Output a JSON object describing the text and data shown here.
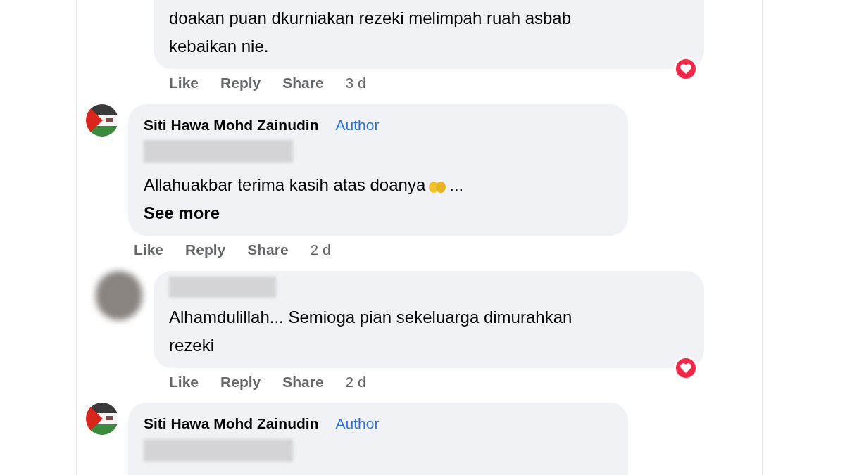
{
  "comments": [
    {
      "kind": "comment",
      "text": "doakan puan dkurniakan rezeki melimpah ruah asbab kebaikan nie.",
      "loved": true,
      "actions": [
        "Like",
        "Reply",
        "Share"
      ],
      "time": "3 d"
    },
    {
      "kind": "reply",
      "author": "Siti Hawa Mohd Zainudin",
      "badge": "Author",
      "text": "Allahuakbar terima kasih atas doanya",
      "emoji_after": true,
      "ellipsis": "...",
      "see_more": "See more",
      "loved": false,
      "actions": [
        "Like",
        "Reply",
        "Share"
      ],
      "time": "2 d"
    },
    {
      "kind": "comment",
      "text": "Alhamdulillah... Semioga pian sekeluarga dimurahkan rezeki",
      "loved": true,
      "actions": [
        "Like",
        "Reply",
        "Share"
      ],
      "time": "2 d"
    },
    {
      "kind": "reply",
      "author": "Siti Hawa Mohd Zainudin",
      "badge": "Author",
      "loved": false
    }
  ]
}
